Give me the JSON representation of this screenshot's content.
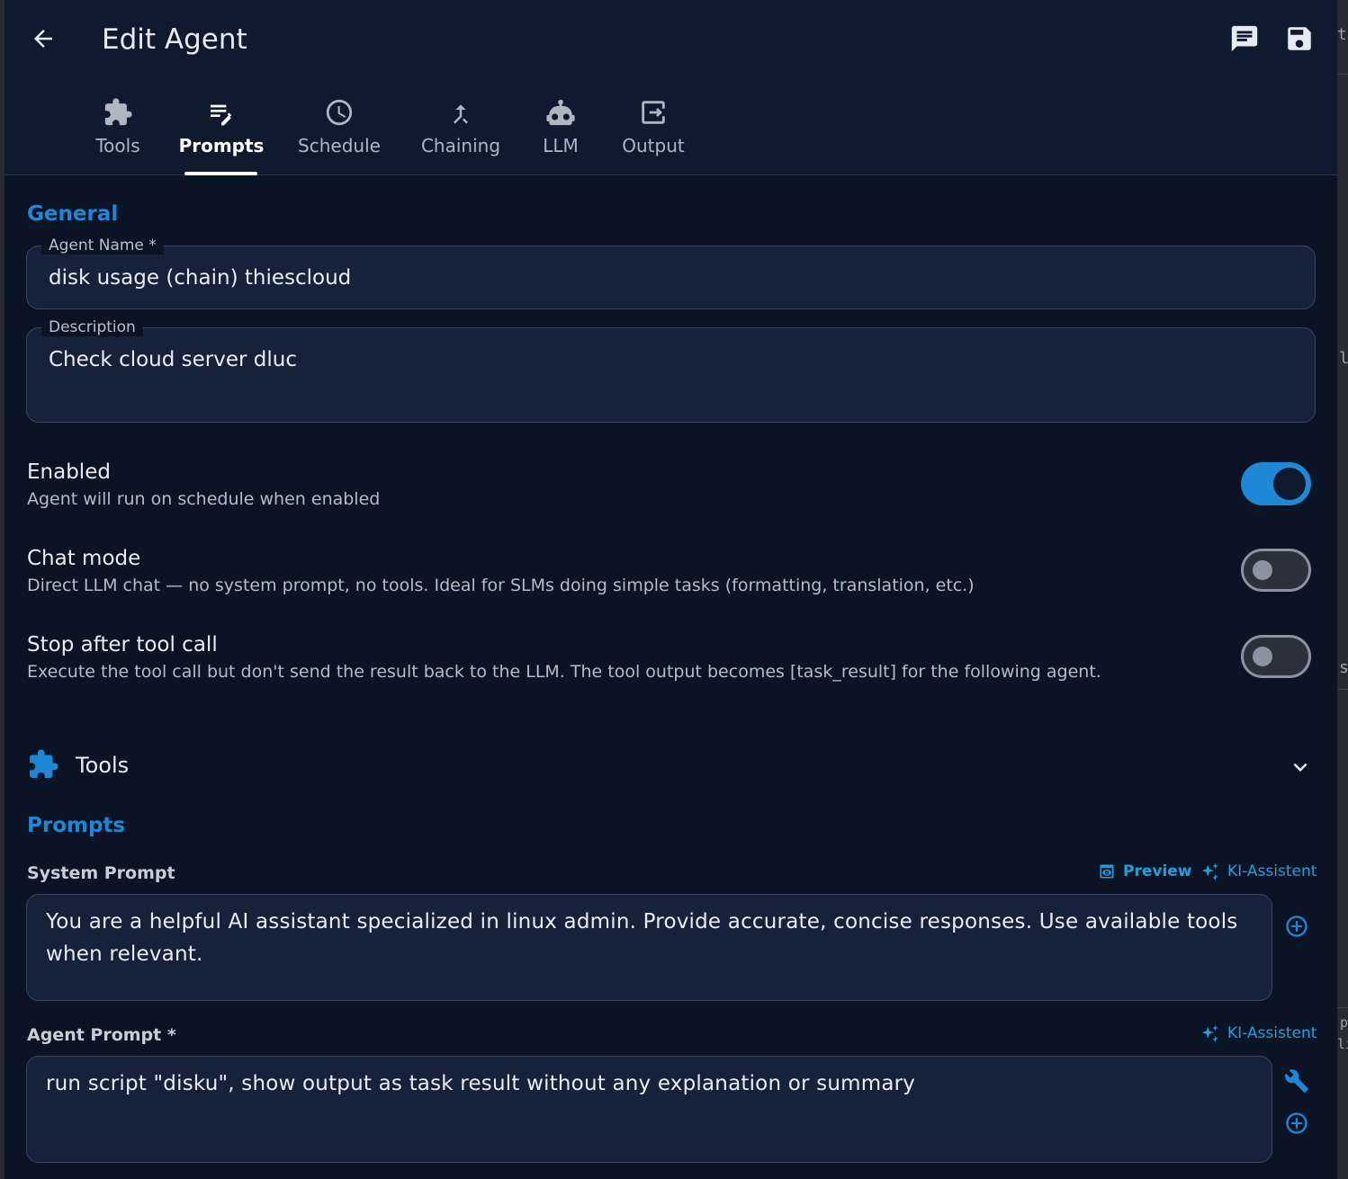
{
  "header": {
    "title": "Edit Agent",
    "back_icon": "arrow-left-icon",
    "chat_icon": "chat-icon",
    "save_icon": "save-icon"
  },
  "tabs": [
    {
      "label": "Tools",
      "icon": "puzzle-icon",
      "active": false
    },
    {
      "label": "Prompts",
      "icon": "text-edit-icon",
      "active": true
    },
    {
      "label": "Schedule",
      "icon": "clock-icon",
      "active": false
    },
    {
      "label": "Chaining",
      "icon": "merge-icon",
      "active": false
    },
    {
      "label": "LLM",
      "icon": "robot-icon",
      "active": false
    },
    {
      "label": "Output",
      "icon": "export-icon",
      "active": false
    }
  ],
  "general": {
    "title": "General",
    "agent_name_label": "Agent Name *",
    "agent_name_value": "disk usage (chain) thiescloud",
    "description_label": "Description",
    "description_value": "Check cloud server dluc"
  },
  "toggles": [
    {
      "title": "Enabled",
      "subtitle": "Agent will run on schedule when enabled",
      "on": true
    },
    {
      "title": "Chat mode",
      "subtitle": "Direct LLM chat — no system prompt, no tools. Ideal for SLMs doing simple tasks (formatting, translation, etc.)",
      "on": false
    },
    {
      "title": "Stop after tool call",
      "subtitle": "Execute the tool call but don't send the result back to the LLM. The tool output becomes [task_result] for the following agent.",
      "on": false
    }
  ],
  "tools_section": {
    "label": "Tools",
    "icon": "puzzle-icon",
    "expand_icon": "chevron-down-icon"
  },
  "prompts": {
    "title": "Prompts",
    "system_prompt_label": "System Prompt",
    "preview_label": "Preview",
    "assistant_label": "KI-Assistent",
    "system_prompt_value": "You are a helpful AI assistant specialized in linux admin. Provide accurate, concise responses. Use available tools when relevant.",
    "agent_prompt_label": "Agent Prompt *",
    "agent_prompt_value": "run  script \"disku\", show output as task result without any explanation or summary"
  },
  "colors": {
    "accent": "#1e88d6",
    "link": "#1ea0dc",
    "background": "#0b1424",
    "header": "#0f1a2e",
    "field": "#16223a"
  },
  "backdrop": {
    "fragments": [
      "ti",
      "l",
      "s",
      "p",
      "lit"
    ]
  }
}
